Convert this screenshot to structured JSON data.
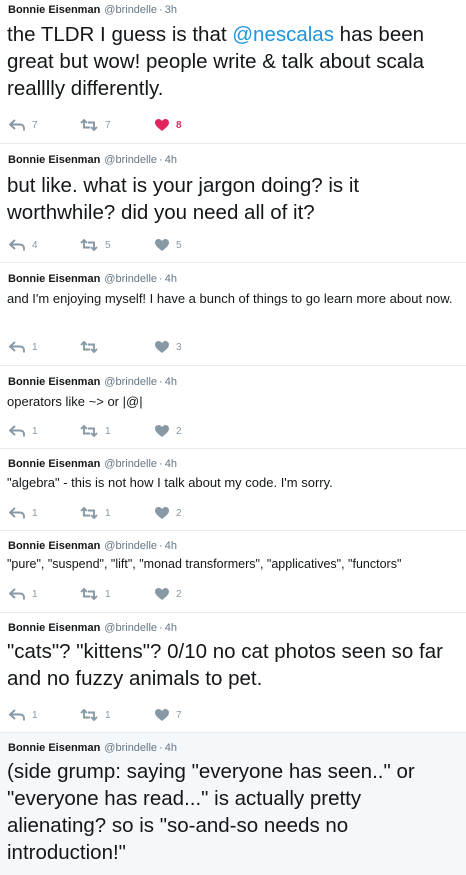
{
  "author": {
    "name": "Bonnie Eisenman",
    "handle": "@brindelle",
    "dot": "·"
  },
  "colors": {
    "link": "#1b95e0",
    "liked": "#e0245e",
    "muted": "#8899a6",
    "highlight": "#f5f8fa"
  },
  "tweets": [
    {
      "time": "3h",
      "text_before": "the TLDR I guess is that ",
      "mention": "@nescalas",
      "text_after": " has been great but wow! people write & talk about scala realllly differently.",
      "replies": "7",
      "retweets": "7",
      "likes": "8",
      "liked": true
    },
    {
      "time": "4h",
      "text": "but like. what is your jargon doing? is it worthwhile? did you need all of it?",
      "replies": "4",
      "retweets": "5",
      "likes": "5"
    },
    {
      "time": "4h",
      "text": "and I'm enjoying myself! I have a bunch of things to go learn more about now.",
      "replies": "1",
      "retweets": "",
      "likes": "3"
    },
    {
      "time": "4h",
      "text": "operators like ~> or |@|",
      "replies": "1",
      "retweets": "1",
      "likes": "2"
    },
    {
      "time": "4h",
      "text": "\"algebra\" - this is not how I talk about my code. I'm sorry.",
      "replies": "1",
      "retweets": "1",
      "likes": "2"
    },
    {
      "time": "4h",
      "text": "\"pure\", \"suspend\", \"lift\", \"monad transformers\", \"applicatives\", \"functors\"",
      "replies": "1",
      "retweets": "1",
      "likes": "2"
    },
    {
      "time": "4h",
      "text": "\"cats\"? \"kittens\"? 0/10 no cat photos seen so far and no fuzzy animals to pet.",
      "replies": "1",
      "retweets": "1",
      "likes": "7"
    },
    {
      "time": "4h",
      "text": "(side grump: saying \"everyone has seen..\" or \"everyone has read...\" is actually pretty alienating? so is \"so-and-so needs no introduction!\""
    }
  ]
}
